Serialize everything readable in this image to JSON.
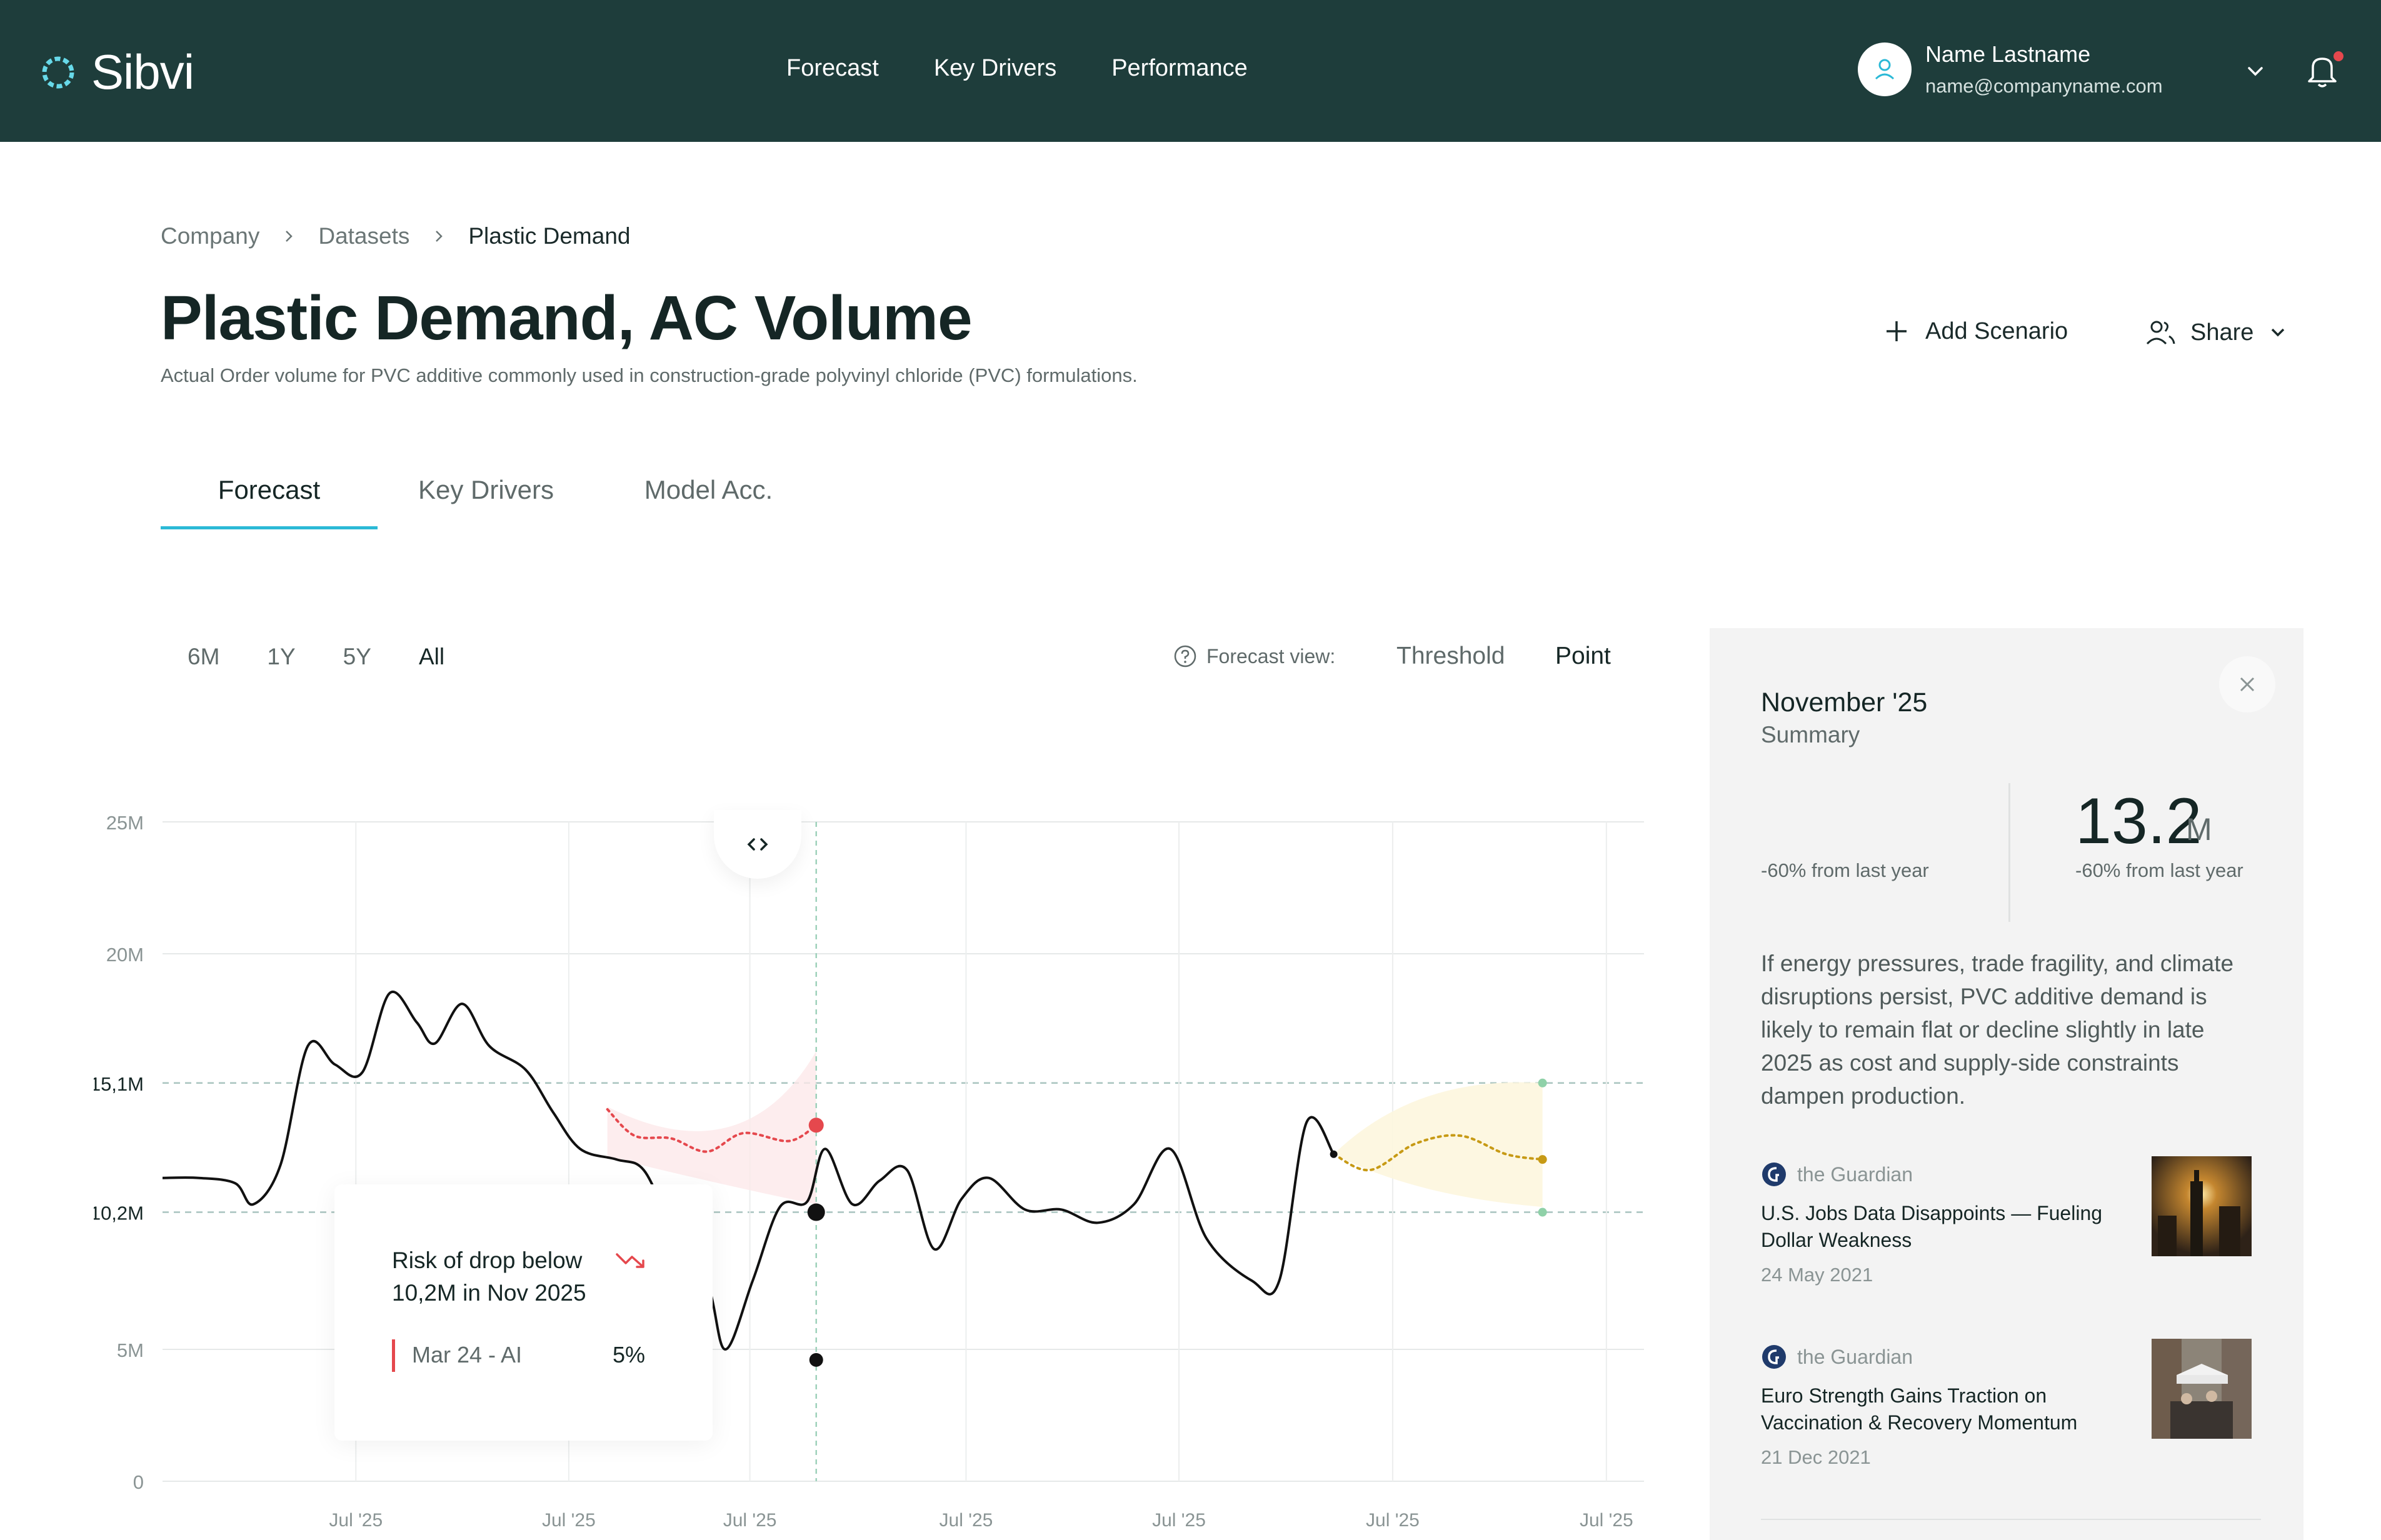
{
  "app": {
    "logo_text": "Sibvi",
    "nav": [
      "Forecast",
      "Key Drivers",
      "Performance"
    ],
    "user": {
      "name": "Name Lastname",
      "email": "name@companyname.com"
    }
  },
  "breadcrumb": [
    "Company",
    "Datasets",
    "Plastic Demand"
  ],
  "page": {
    "title": "Plastic Demand, AC Volume",
    "subtitle": "Actual Order volume for PVC additive commonly used in construction-grade polyvinyl chloride (PVC) formulations.",
    "add_scenario": "Add Scenario",
    "share": "Share"
  },
  "tabs": [
    "Forecast",
    "Key Drivers",
    "Model Acc."
  ],
  "controls": {
    "ranges": [
      "6M",
      "1Y",
      "5Y",
      "All"
    ],
    "forecast_view_label": "Forecast view:",
    "threshold": "Threshold",
    "point": "Point"
  },
  "chart_data": {
    "type": "line",
    "y_ticks": [
      "25M",
      "20M",
      "15,1M",
      "10,2M",
      "5M",
      "0"
    ],
    "x_ticks": [
      "Jul '25",
      "Jul '25",
      "Jul '25",
      "Jul '25",
      "Jul '25",
      "Jul '25",
      "Jul '25"
    ],
    "ylim": [
      0,
      25
    ],
    "thresholds": [
      15.1,
      10.2
    ],
    "history": [
      [
        0,
        11.5
      ],
      [
        0.4,
        11.5
      ],
      [
        0.8,
        11.3
      ],
      [
        1.0,
        10.5
      ],
      [
        1.3,
        12
      ],
      [
        1.6,
        16.5
      ],
      [
        1.9,
        15.8
      ],
      [
        2.2,
        15.5
      ],
      [
        2.5,
        18.5
      ],
      [
        2.8,
        17.4
      ],
      [
        3.0,
        16.6
      ],
      [
        3.3,
        18.1
      ],
      [
        3.6,
        16.5
      ],
      [
        4.0,
        15.6
      ],
      [
        4.3,
        14
      ],
      [
        4.6,
        12.6
      ],
      [
        5.0,
        12.2
      ],
      [
        5.3,
        11.8
      ],
      [
        5.6,
        9.7
      ],
      [
        6.0,
        7.5
      ],
      [
        6.2,
        5
      ],
      [
        6.5,
        7.6
      ],
      [
        6.8,
        10.4
      ],
      [
        7.1,
        10.6
      ],
      [
        7.3,
        12.6
      ],
      [
        7.6,
        10.5
      ],
      [
        7.9,
        11.4
      ],
      [
        8.2,
        11.8
      ],
      [
        8.5,
        8.8
      ],
      [
        8.8,
        10.7
      ],
      [
        9.1,
        11.5
      ],
      [
        9.5,
        10.3
      ],
      [
        9.9,
        10.3
      ],
      [
        10.3,
        9.8
      ],
      [
        10.7,
        10.5
      ],
      [
        11.1,
        12.6
      ],
      [
        11.5,
        9.2
      ],
      [
        12.0,
        7.6
      ],
      [
        12.3,
        7.6
      ],
      [
        12.6,
        13.6
      ],
      [
        12.9,
        12.4
      ]
    ],
    "forecast_red": [
      [
        4.9,
        14.1
      ],
      [
        5.2,
        13.1
      ],
      [
        5.6,
        13.0
      ],
      [
        6.0,
        12.5
      ],
      [
        6.4,
        13.2
      ],
      [
        6.9,
        12.9
      ],
      [
        7.2,
        13.5
      ]
    ],
    "forecast_yellow": [
      [
        12.9,
        12.4
      ],
      [
        13.3,
        11.8
      ],
      [
        13.8,
        12.8
      ],
      [
        14.3,
        13.1
      ],
      [
        14.8,
        12.4
      ],
      [
        15.2,
        12.2
      ]
    ],
    "markers": {
      "red": [
        7.2,
        13.5
      ],
      "threshold_point": [
        7.2,
        10.2
      ],
      "low_point": [
        7.2,
        4.6
      ]
    }
  },
  "risk": {
    "title": "Risk of drop below 10,2M in Nov 2025",
    "source": "Mar 24 - AI",
    "value": "5%"
  },
  "summary": {
    "month": "November '25",
    "label": "Summary",
    "change_left": "-60% from last year",
    "value": "13.2",
    "unit": "M",
    "change_right": "-60% from last year",
    "text": "If energy pressures, trade fragility, and climate disruptions persist, PVC additive demand is likely to remain flat or decline slightly in late 2025 as cost and supply-side constraints dampen production."
  },
  "news": [
    {
      "source": "the Guardian",
      "headline": "U.S. Jobs Data Disappoints — Fueling Dollar Weakness",
      "date": "24 May 2021"
    },
    {
      "source": "the Guardian",
      "headline": "Euro Strength Gains Traction on Vaccination & Recovery Momentum",
      "date": "21 Dec 2021"
    }
  ],
  "colors": {
    "topbar": "#1e3d3b",
    "accent": "#2bb9d6",
    "risk": "#e5484d",
    "forecast_yellow": "#c79a15",
    "threshold": "#8fd1a8"
  },
  "icons": {
    "logo": "ring-logo-icon",
    "avatar": "user-icon",
    "chevron": "chevron-down-icon",
    "bell": "bell-icon",
    "add": "plus-icon",
    "share": "users-icon",
    "help": "help-icon",
    "close": "close-icon",
    "trend": "trend-down-icon",
    "handle": "drag-handle-icon",
    "news_source": "guardian-logo-icon"
  }
}
